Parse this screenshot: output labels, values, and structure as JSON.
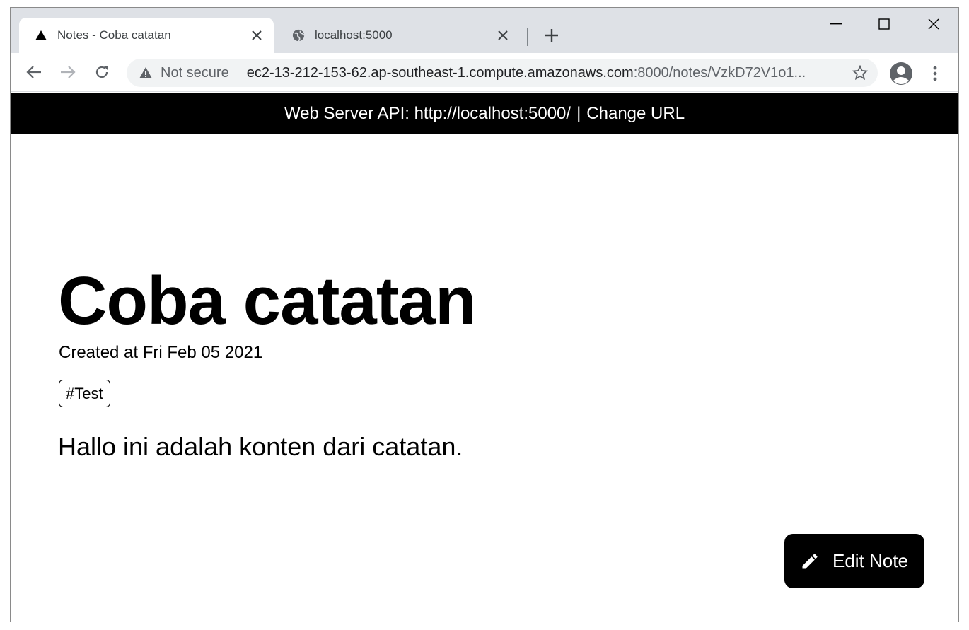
{
  "browser": {
    "tabs": [
      {
        "title": "Notes - Coba catatan",
        "favicon": "triangle-icon",
        "active": true
      },
      {
        "title": "localhost:5000",
        "favicon": "globe-icon",
        "active": false
      }
    ],
    "address": {
      "security_label": "Not secure",
      "host": "ec2-13-212-153-62.ap-southeast-1.compute.amazonaws.com",
      "path": ":8000/notes/VzkD72V1o1..."
    }
  },
  "banner": {
    "prefix": "Web Server API: http://localhost:5000/",
    "separator": "|",
    "change_label": "Change URL"
  },
  "note": {
    "title": "Coba catatan",
    "created": "Created at Fri Feb 05 2021",
    "tags": [
      "#Test"
    ],
    "body": "Hallo ini adalah konten dari catatan."
  },
  "actions": {
    "edit_label": "Edit Note",
    "edit_icon": "pencil-icon"
  },
  "colors": {
    "banner_bg": "#000000",
    "button_bg": "#000000",
    "tabstrip_bg": "#dee1e6",
    "omnibox_bg": "#f1f3f4"
  }
}
